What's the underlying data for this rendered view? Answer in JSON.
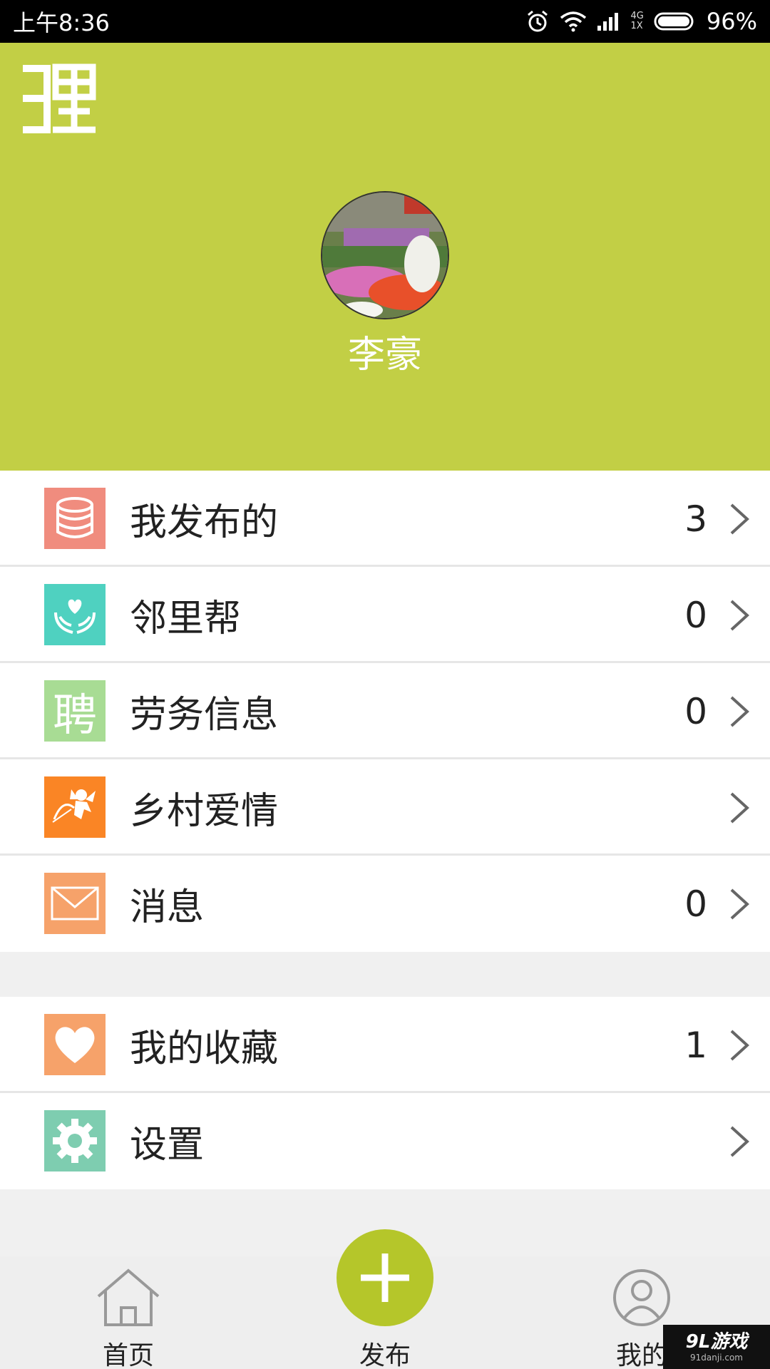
{
  "status_bar": {
    "time": "上午8:36",
    "network_top": "4G",
    "network_bottom": "1X",
    "battery": "96%"
  },
  "header": {
    "logo_text": "3里",
    "user_name": "李豪",
    "background_color": "#c2cf45"
  },
  "menu": {
    "items": [
      {
        "label": "我发布的",
        "count": "3",
        "icon": "database-icon",
        "icon_color": "#f08c7e"
      },
      {
        "label": "邻里帮",
        "count": "0",
        "icon": "heart-hands-icon",
        "icon_color": "#4fd1c0"
      },
      {
        "label": "劳务信息",
        "count": "0",
        "icon": "recruit-icon",
        "icon_glyph": "聘",
        "icon_color": "#a8dc94"
      },
      {
        "label": "乡村爱情",
        "count": "",
        "icon": "cupid-icon",
        "icon_color": "#fa8525"
      },
      {
        "label": "消息",
        "count": "0",
        "icon": "envelope-icon",
        "icon_color": "#f6a26a"
      }
    ],
    "items_b": [
      {
        "label": "我的收藏",
        "count": "1",
        "icon": "heart-icon",
        "icon_color": "#f6a26a"
      },
      {
        "label": "设置",
        "count": "",
        "icon": "gear-icon",
        "icon_color": "#7ecdb0"
      }
    ]
  },
  "tab_bar": {
    "home_label": "首页",
    "publish_label": "发布",
    "me_label": "我的",
    "accent_color": "#b5c62a"
  },
  "watermark": {
    "main": "9L游戏",
    "sub": "91danji.com"
  }
}
